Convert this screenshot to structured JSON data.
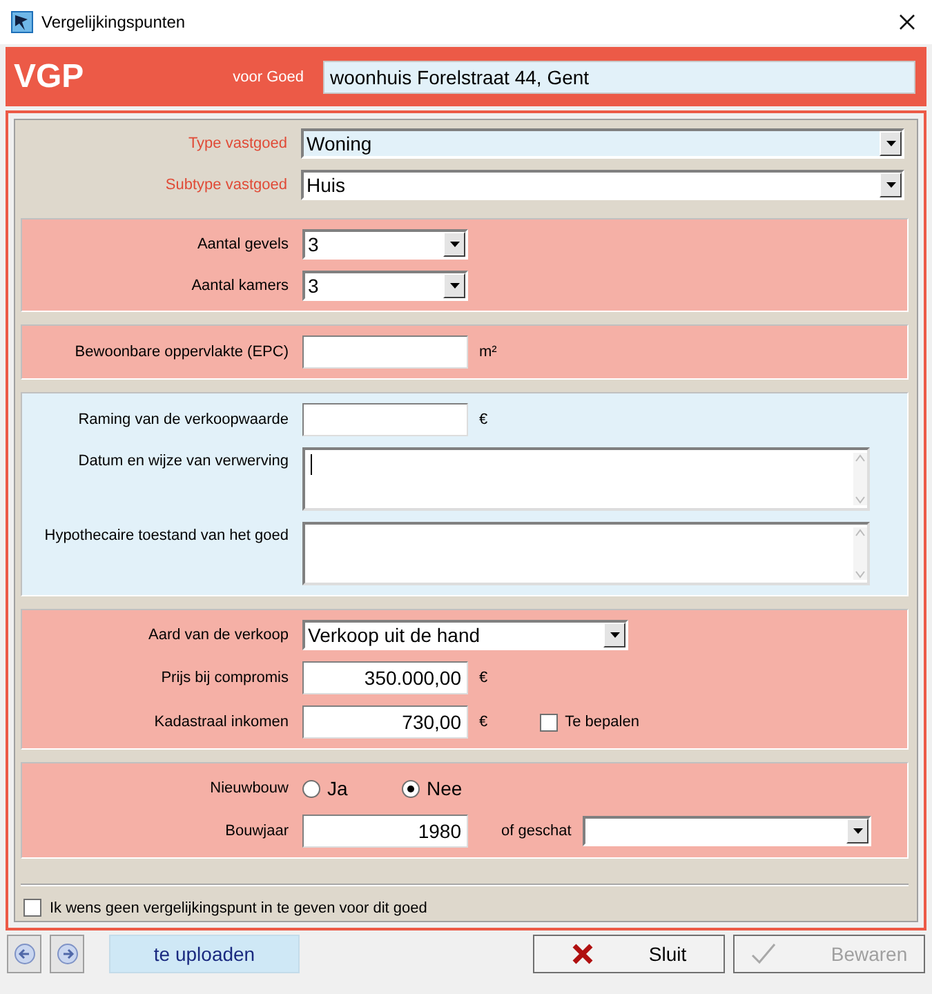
{
  "window": {
    "title": "Vergelijkingspunten"
  },
  "header": {
    "logo": "VGP",
    "label": "voor Goed",
    "value": "woonhuis Forelstraat 44, Gent"
  },
  "sections": [
    {
      "rows": [
        {
          "label": "Type vastgoed",
          "required": true,
          "fields": [
            {
              "kind": "wideselect",
              "value": "Woning",
              "focused": true
            }
          ]
        },
        {
          "label": "Subtype vastgoed",
          "required": true,
          "fields": [
            {
              "kind": "wideselect",
              "value": "Huis",
              "focused": false
            }
          ]
        }
      ]
    },
    {
      "color": "#f5b0a6",
      "rows": [
        {
          "label": "Aantal gevels",
          "required": false,
          "fields": [
            {
              "kind": "shortselect",
              "value": "3",
              "focused": false
            }
          ]
        },
        {
          "label": "Aantal kamers",
          "required": false,
          "fields": [
            {
              "kind": "shortselect",
              "value": "3",
              "focused": false
            }
          ]
        }
      ]
    },
    {
      "color": "#f5b0a6",
      "rows": [
        {
          "label": "Bewoonbare oppervlakte (EPC)",
          "required": false,
          "fields": [
            {
              "kind": "text"
            },
            {
              "kind": "unit",
              "text": "m²"
            }
          ]
        }
      ]
    },
    {
      "color": "#e2f1f9",
      "rows": [
        {
          "label": "Raming van de verkoopwaarde",
          "required": false,
          "fields": [
            {
              "kind": "text"
            },
            {
              "kind": "unit",
              "text": "€"
            }
          ]
        },
        {
          "label": "Datum en wijze van verwerving",
          "required": false,
          "fields": [
            {
              "kind": "textarea",
              "focused": true
            }
          ]
        },
        {
          "label": "Hypothecaire toestand van het goed",
          "required": false,
          "fields": [
            {
              "kind": "textarea",
              "focused": false
            }
          ]
        }
      ]
    },
    {
      "color": "#f5b0a6",
      "rows": [
        {
          "label": "Aard van de verkoop",
          "required": false,
          "fields": [
            {
              "kind": "midselect",
              "value": "Verkoop uit de hand",
              "focused": false
            }
          ]
        },
        {
          "label": "Prijs bij compromis",
          "required": false,
          "fields": [
            {
              "kind": "number",
              "value": "350.000,00"
            },
            {
              "kind": "unit",
              "text": "€"
            }
          ]
        },
        {
          "label": "Kadastraal inkomen",
          "required": false,
          "fields": [
            {
              "kind": "number",
              "value": "730,00"
            },
            {
              "kind": "unit",
              "text": "€"
            },
            {
              "kind": "checkbox",
              "label": "Te bepalen",
              "checked": false
            }
          ]
        }
      ]
    },
    {
      "color": "#f5b0a6",
      "rows": [
        {
          "label": "Nieuwbouw",
          "required": false,
          "fields": [
            {
              "kind": "radio",
              "label": "Ja",
              "selected": false
            },
            {
              "kind": "radio",
              "label": "Nee",
              "selected": true
            }
          ]
        },
        {
          "label": "Bouwjaar",
          "required": false,
          "fields": [
            {
              "kind": "number",
              "value": "1980"
            },
            {
              "kind": "caption",
              "text": "of geschat"
            },
            {
              "kind": "fillselect",
              "focused": false
            }
          ]
        }
      ]
    }
  ],
  "opt_out": {
    "label": "Ik wens geen vergelijkingspunt in te geven voor dit goed",
    "checked": false
  },
  "footer": {
    "status": "te uploaden",
    "buttons": [
      {
        "kind": "close",
        "label": "Sluit",
        "disabled": false
      },
      {
        "kind": "save",
        "label": "Bewaren",
        "disabled": true
      }
    ]
  }
}
